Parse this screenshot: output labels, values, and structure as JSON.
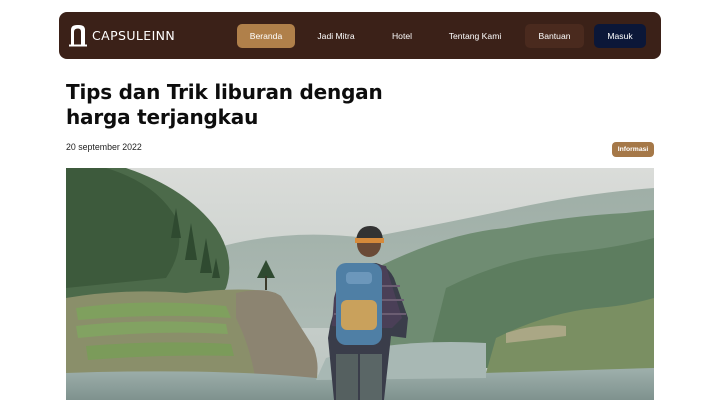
{
  "brand": {
    "name": "CAPSULEINN",
    "logo_icon": "capsule-logo-icon"
  },
  "nav": {
    "items": [
      {
        "label": "Beranda",
        "active": true
      },
      {
        "label": "Jadi Mitra"
      },
      {
        "label": "Hotel"
      },
      {
        "label": "Tentang Kami"
      },
      {
        "label": "Bantuan"
      }
    ],
    "login_label": "Masuk"
  },
  "article": {
    "title_line1": "Tips dan Trik liburan dengan",
    "title_line2": "harga terjangkau",
    "date": "20 september 2022",
    "category": "Informasi"
  },
  "colors": {
    "navbar": "#3b2118",
    "accent": "#b0804a",
    "badge": "#a57848",
    "login": "#0b1738"
  }
}
